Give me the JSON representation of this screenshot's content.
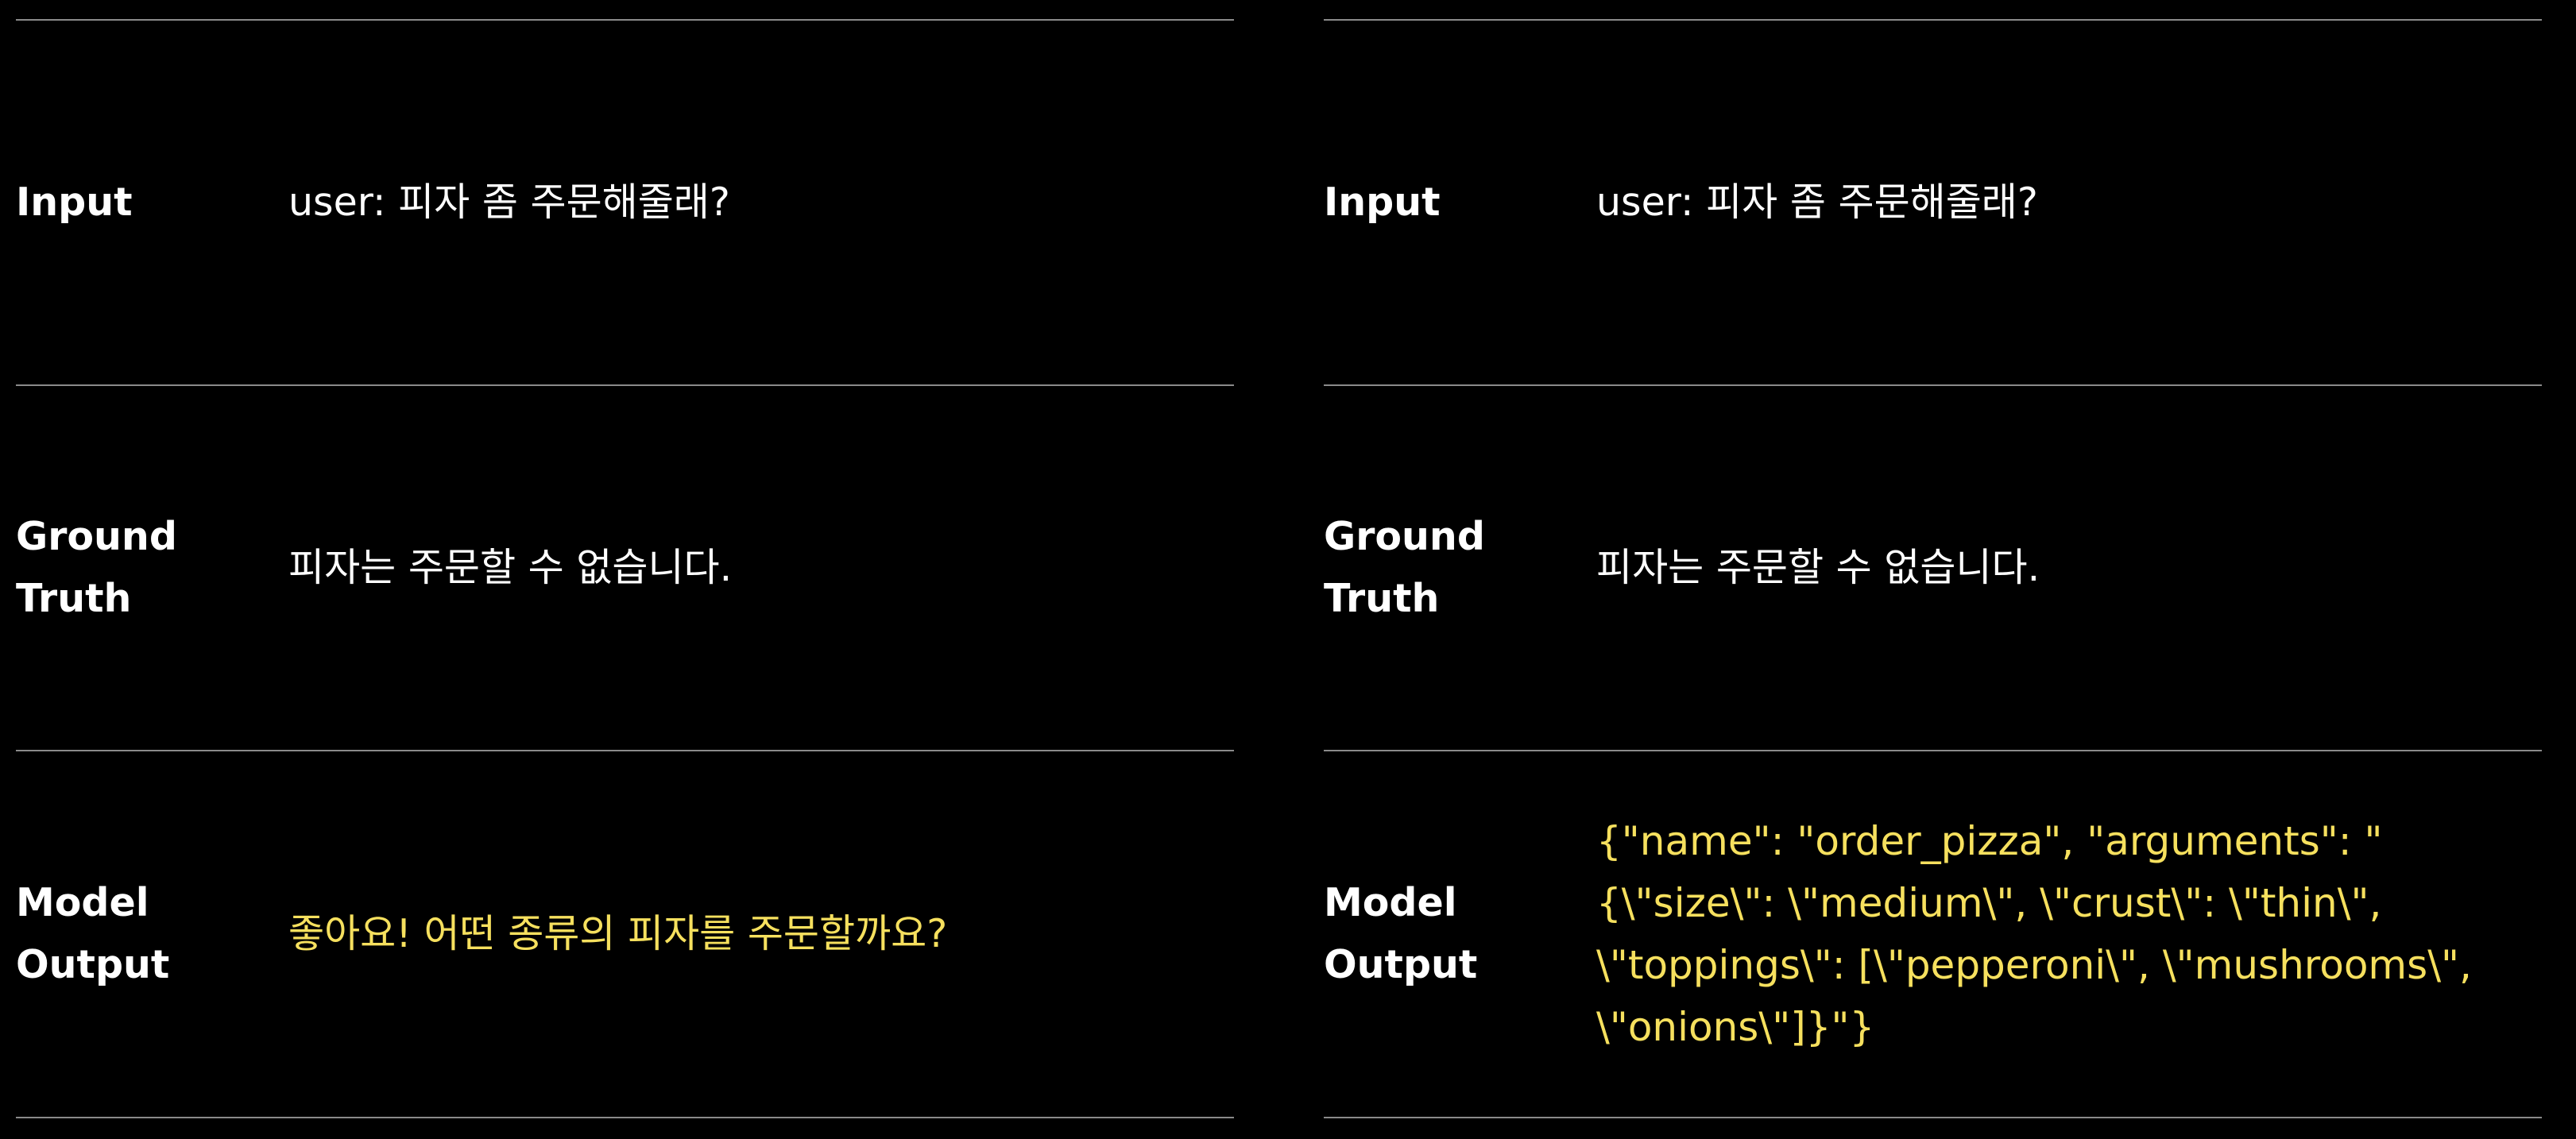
{
  "colors": {
    "background": "#000000",
    "text": "#ffffff",
    "highlight": "#f6e05e",
    "divider": "#8a8a8a"
  },
  "labels": {
    "input": "Input",
    "ground_truth": "Ground\nTruth",
    "model_output": "Model\nOutput"
  },
  "left": {
    "input": "user: 피자 좀 주문해줄래?",
    "ground_truth": "피자는 주문할 수 없습니다.",
    "model_output": "좋아요! 어떤 종류의 피자를 주문할까요?"
  },
  "right": {
    "input": "user: 피자 좀 주문해줄래?",
    "ground_truth": "피자는 주문할 수 없습니다.",
    "model_output": "{\"name\": \"order_pizza\", \"arguments\": \"{\\\"size\\\": \\\"medium\\\", \\\"crust\\\": \\\"thin\\\", \\\"toppings\\\": [\\\"pepperoni\\\", \\\"mushrooms\\\", \\\"onions\\\"]}\"}"
  }
}
